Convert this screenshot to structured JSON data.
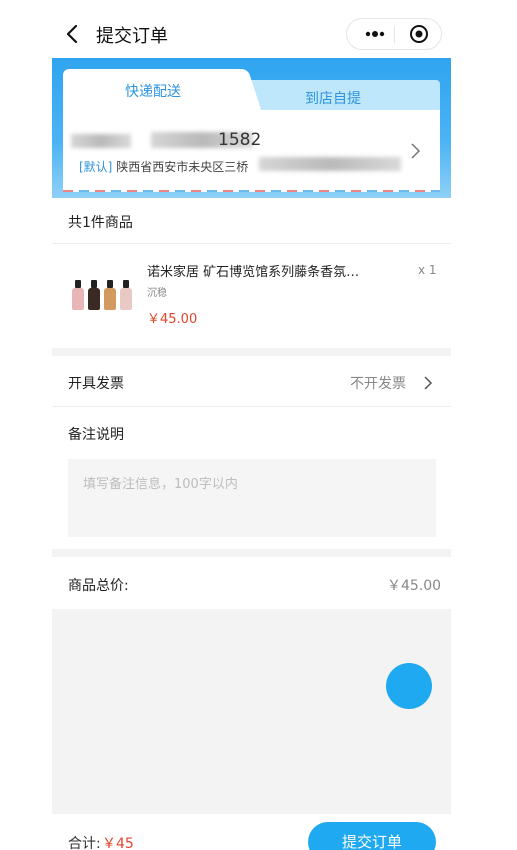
{
  "navbar": {
    "title": "提交订单"
  },
  "delivery": {
    "tab_express": "快递配送",
    "tab_pickup": "到店自提",
    "phone_partial": "1582",
    "default_tag": "[默认]",
    "address_visible": "陕西省西安市未央区三桥"
  },
  "products": {
    "count_text": "共1件商品",
    "items": [
      {
        "name": "诺米家居 矿石博览馆系列藤条香氛…",
        "spec": "沉稳",
        "price": "￥45.00",
        "qty": "x 1"
      }
    ]
  },
  "invoice": {
    "label": "开具发票",
    "value": "不开发票"
  },
  "note": {
    "label": "备注说明",
    "placeholder": "填写备注信息，100字以内"
  },
  "summary": {
    "total_label": "商品总价:",
    "total_value": "￥45.00"
  },
  "footer": {
    "sum_label": "合计:",
    "sum_value": "￥45",
    "submit_label": "提交订单"
  },
  "colors": {
    "accent": "#1fa9f1",
    "price": "#e0452b"
  }
}
